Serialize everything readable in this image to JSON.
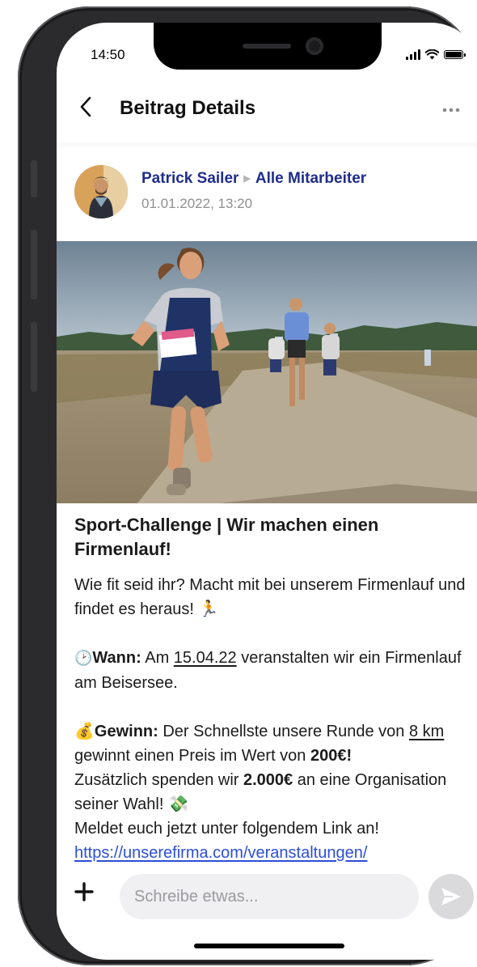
{
  "status_bar": {
    "time": "14:50"
  },
  "header": {
    "back_icon": "chevron-left-icon",
    "title": "Beitrag Details",
    "more_icon": "more-horizontal-icon"
  },
  "post": {
    "author": "Patrick Sailer",
    "audience": "Alle Mitarbeiter",
    "date": "01.01.2022, 13:20",
    "image_alt": "runner-photo",
    "title": "Sport-Challenge | Wir machen einen Firmenlauf!",
    "intro": "Wie fit seid ihr? Macht mit bei unserem Firmenlauf und findet es heraus!",
    "when_label": "Wann:",
    "when_pre": "Am",
    "when_date": "15.04.22",
    "when_post": "veranstalten wir ein Firmenlauf am Beisersee.",
    "prize_label": "Gewinn:",
    "prize_pre": "Der Schnellste unsere Runde von",
    "prize_distance": "8 km",
    "prize_mid": "gewinnt einen Preis im Wert von",
    "prize_amount": "200€",
    "prize_end": "!",
    "donation_pre": "Zusätzlich spenden wir",
    "donation_amount": "2.000€",
    "donation_post": "an eine Organisation seiner Wahl!",
    "signup_text": "Meldet euch jetzt unter folgendem Link an!",
    "link": "https://unserefirma.com/veranstaltungen/"
  },
  "composer": {
    "placeholder": "Schreibe etwas...",
    "add_icon": "plus-icon",
    "send_icon": "send-icon"
  },
  "colors": {
    "author": "#1f2d8c",
    "link": "#2c4ed6",
    "input_bg": "#f0f0f2"
  }
}
